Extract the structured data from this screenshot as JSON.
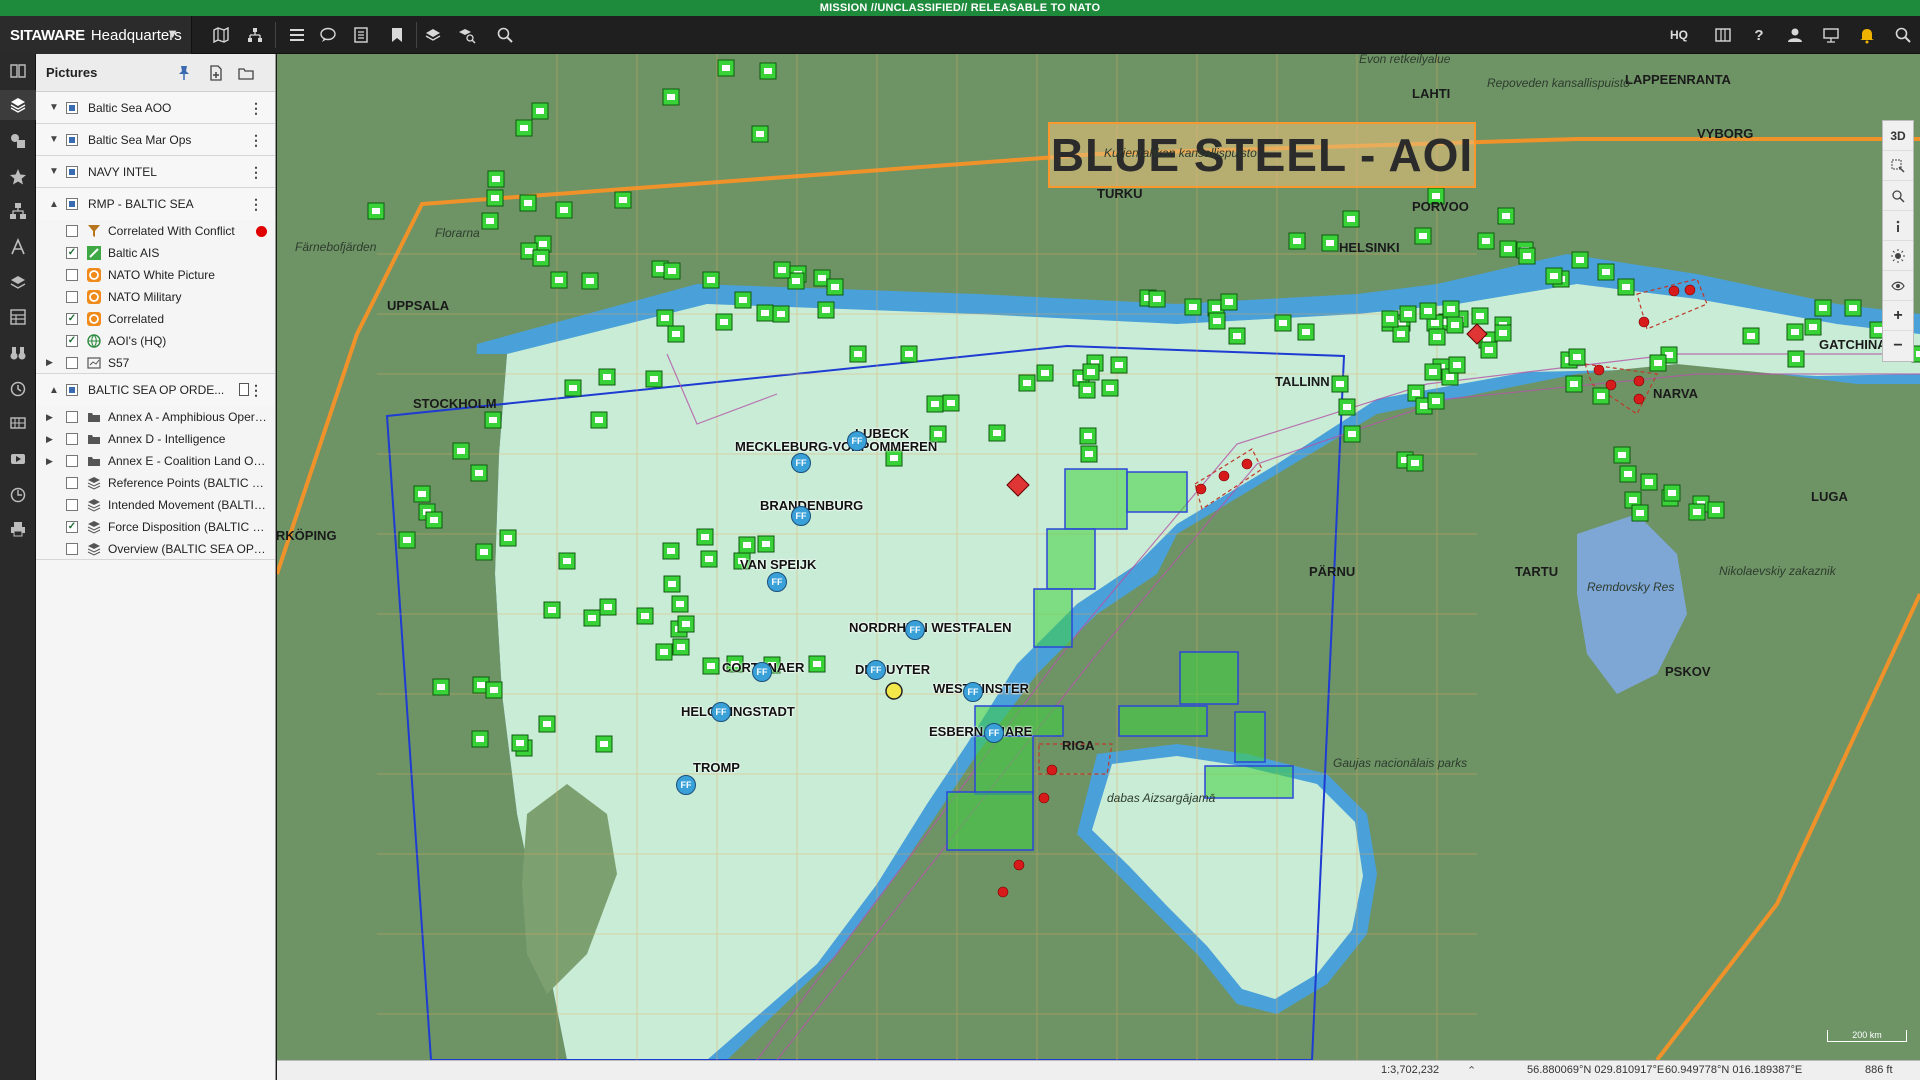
{
  "banner": {
    "text": "MISSION //UNCLASSIFIED// RELEASABLE TO NATO"
  },
  "app": {
    "brand": "SITAWARE",
    "workspace": "Headquarters",
    "hq_label": "HQ"
  },
  "toolbar": {
    "icons": [
      "map-icon",
      "hierarchy-icon",
      "menu-icon",
      "chat-icon",
      "list-icon",
      "bookmark-icon",
      "layers-icon",
      "find-layers-icon",
      "search-icon"
    ],
    "right_icons": [
      "panel-icon",
      "help-icon",
      "user-icon",
      "presentation-icon",
      "bell-icon",
      "search-icon"
    ]
  },
  "leftrail": {
    "icons": [
      "book-icon",
      "layers-icon",
      "shapes-icon",
      "star-icon",
      "org-icon",
      "route-icon",
      "stack-icon",
      "grid-icon",
      "binoculars-icon",
      "history-icon",
      "table-icon",
      "video-icon",
      "clock-icon",
      "print-icon"
    ]
  },
  "panel": {
    "title": "Pictures",
    "groups": [
      {
        "label": "Baltic Sea AOO"
      },
      {
        "label": "Baltic Sea Mar Ops"
      },
      {
        "label": "NAVY INTEL"
      },
      {
        "label": "RMP - BALTIC SEA"
      }
    ],
    "rmp_items": [
      {
        "label": "Correlated With Conflict",
        "checked": false,
        "status": "conflict"
      },
      {
        "label": "Baltic AIS",
        "checked": true
      },
      {
        "label": "NATO White Picture",
        "checked": false
      },
      {
        "label": "NATO Military",
        "checked": false
      },
      {
        "label": "Correlated",
        "checked": true
      },
      {
        "label": "AOI's (HQ)",
        "checked": true
      },
      {
        "label": "S57",
        "checked": false
      }
    ],
    "op_order_group": {
      "label": "BALTIC SEA OP ORDE..."
    },
    "op_items": [
      {
        "label": "Annex A - Amphibious Opera...",
        "checked": false
      },
      {
        "label": "Annex D - Intelligence",
        "checked": false
      },
      {
        "label": "Annex E - Coalition Land Op...",
        "checked": false
      },
      {
        "label": "Reference Points (BALTIC SE...",
        "checked": false
      },
      {
        "label": "Intended Movement (BALTIC...",
        "checked": false
      },
      {
        "label": "Force Disposition (BALTIC S...",
        "checked": true
      },
      {
        "label": "Overview (BALTIC SEA OP O...",
        "checked": false
      }
    ]
  },
  "map": {
    "aoi_title": "BLUE STEEL - AOI",
    "place_labels": [
      "LAHTI",
      "LAPPEENRANTA",
      "VYBORG",
      "PORVOO",
      "HELSINKI",
      "UPPSALA",
      "STOCKHOLM",
      "NORRKÖPING",
      "TALLINN",
      "PÄRNU",
      "TARTU",
      "NARVA",
      "PSKOV",
      "LUGA",
      "GATCHINA",
      "RIGA",
      "TURKU"
    ],
    "italic_labels": [
      "Evon retkeilyalue",
      "Repoveden kansallispuisto",
      "Kurjenrahkan kansallispuisto",
      "Florarna",
      "Färnebofjärden",
      "Remdovsky Res",
      "Nikolaevskiy zakaznik",
      "Gaujas nacionālais parks",
      "dabas Aizsargājamā"
    ],
    "units": [
      "MECKLEBURG-VORPOMMEREN",
      "LUBECK",
      "BRANDENBURG",
      "VAN SPEIJK",
      "NORDRHEIN WESTFALEN",
      "DE RUYTER",
      "CORTENAER",
      "WESTMINSTER",
      "HELGE INGSTADT",
      "ESBERN SNARE",
      "TROMP"
    ],
    "ff_label": "FF",
    "scale_label": "200 km"
  },
  "maptools": {
    "items": [
      "3D",
      "select-icon",
      "zoom-select-icon",
      "info-icon",
      "brightness-icon",
      "eye-icon",
      "+",
      "−"
    ]
  },
  "statusbar": {
    "scale": "1:3,702,232",
    "coord1": "56.880069°N 029.810917°E",
    "coord2": "60.949778°N 016.189387°E",
    "altitude": "886 ft"
  },
  "colors": {
    "banner": "#1e8a3c",
    "aoi_border": "#f0922a",
    "op_area": "#1e3cd2",
    "friendly_box": "#33cc33"
  }
}
